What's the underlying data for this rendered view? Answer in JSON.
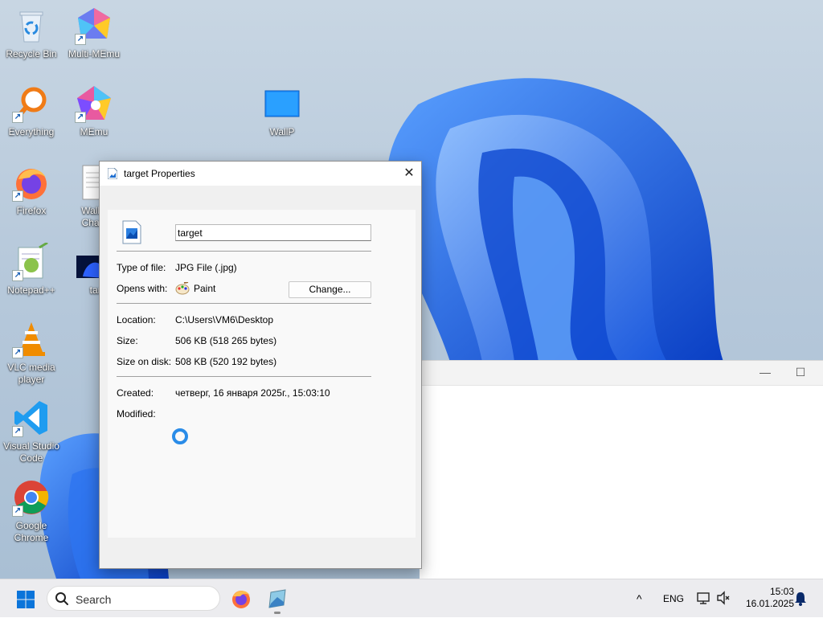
{
  "desktop": {
    "icons": [
      {
        "label": "Recycle Bin"
      },
      {
        "label": "Multi-MEmu"
      },
      {
        "label": "Everything"
      },
      {
        "label": "MEmu"
      },
      {
        "label": "WallP"
      },
      {
        "label": "Firefox"
      },
      {
        "label": "Wallp... Chan..."
      },
      {
        "label": "Notepad++"
      },
      {
        "label": "targ..."
      },
      {
        "label": "VLC media player"
      },
      {
        "label": "Visual Studio Code"
      },
      {
        "label": "Google Chrome"
      }
    ]
  },
  "background_window": {
    "minimize": "—",
    "maximize": "☐"
  },
  "dialog": {
    "title": "target Properties",
    "close": "✕",
    "file_name": "target",
    "fields": {
      "type_label": "Type of file:",
      "type_value": "JPG File (.jpg)",
      "opens_label": "Opens with:",
      "opens_value": "Paint",
      "change_button": "Change...",
      "location_label": "Location:",
      "location_value": "C:\\Users\\VM6\\Desktop",
      "size_label": "Size:",
      "size_value": "506 KB (518 265 bytes)",
      "disk_label": "Size on disk:",
      "disk_value": "508 KB (520 192 bytes)",
      "created_label": "Created:",
      "created_value": "четверг, 16 января 2025г., 15:03:10",
      "modified_label": "Modified:"
    }
  },
  "taskbar": {
    "search_placeholder": "Search",
    "language": "ENG",
    "time": "15:03",
    "date": "16.01.2025",
    "chevron": "^"
  },
  "colors": {
    "accent": "#0078d4",
    "wallpaper_blue": "#1a5fd9",
    "spinner": "#2a8ce8"
  }
}
